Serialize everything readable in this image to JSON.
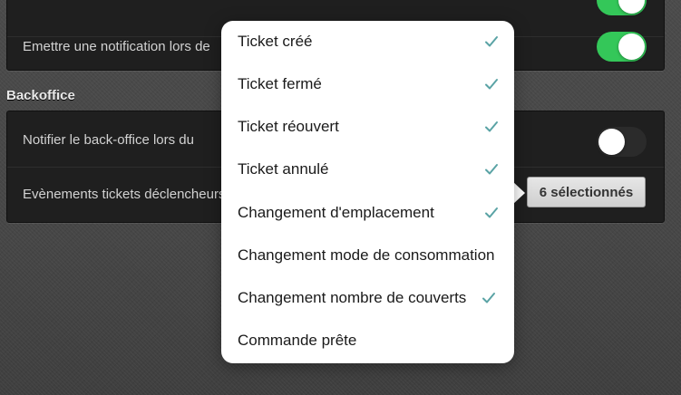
{
  "settings": {
    "notification_row_label": "Emettre une notification lors de",
    "section_title": "Backoffice",
    "notify_backoffice_label": "Notifier le back-office lors du",
    "ticket_events_label": "Evènements tickets déclencheurs",
    "count_button_label": "6 sélectionnés",
    "toggles": {
      "top_partial": "on",
      "notification": "on",
      "notify_backoffice": "off"
    }
  },
  "popover": {
    "options": [
      {
        "label": "Ticket créé",
        "checked": true
      },
      {
        "label": "Ticket fermé",
        "checked": true
      },
      {
        "label": "Ticket réouvert",
        "checked": true
      },
      {
        "label": "Ticket annulé",
        "checked": true
      },
      {
        "label": "Changement d'emplacement",
        "checked": true
      },
      {
        "label": "Changement mode de consommation",
        "checked": false
      },
      {
        "label": "Changement nombre de couverts",
        "checked": true
      },
      {
        "label": "Commande prête",
        "checked": false
      }
    ]
  },
  "colors": {
    "toggle_on": "#34c759",
    "checkmark": "#5aa3a5",
    "popover_bg": "#ffffff"
  }
}
